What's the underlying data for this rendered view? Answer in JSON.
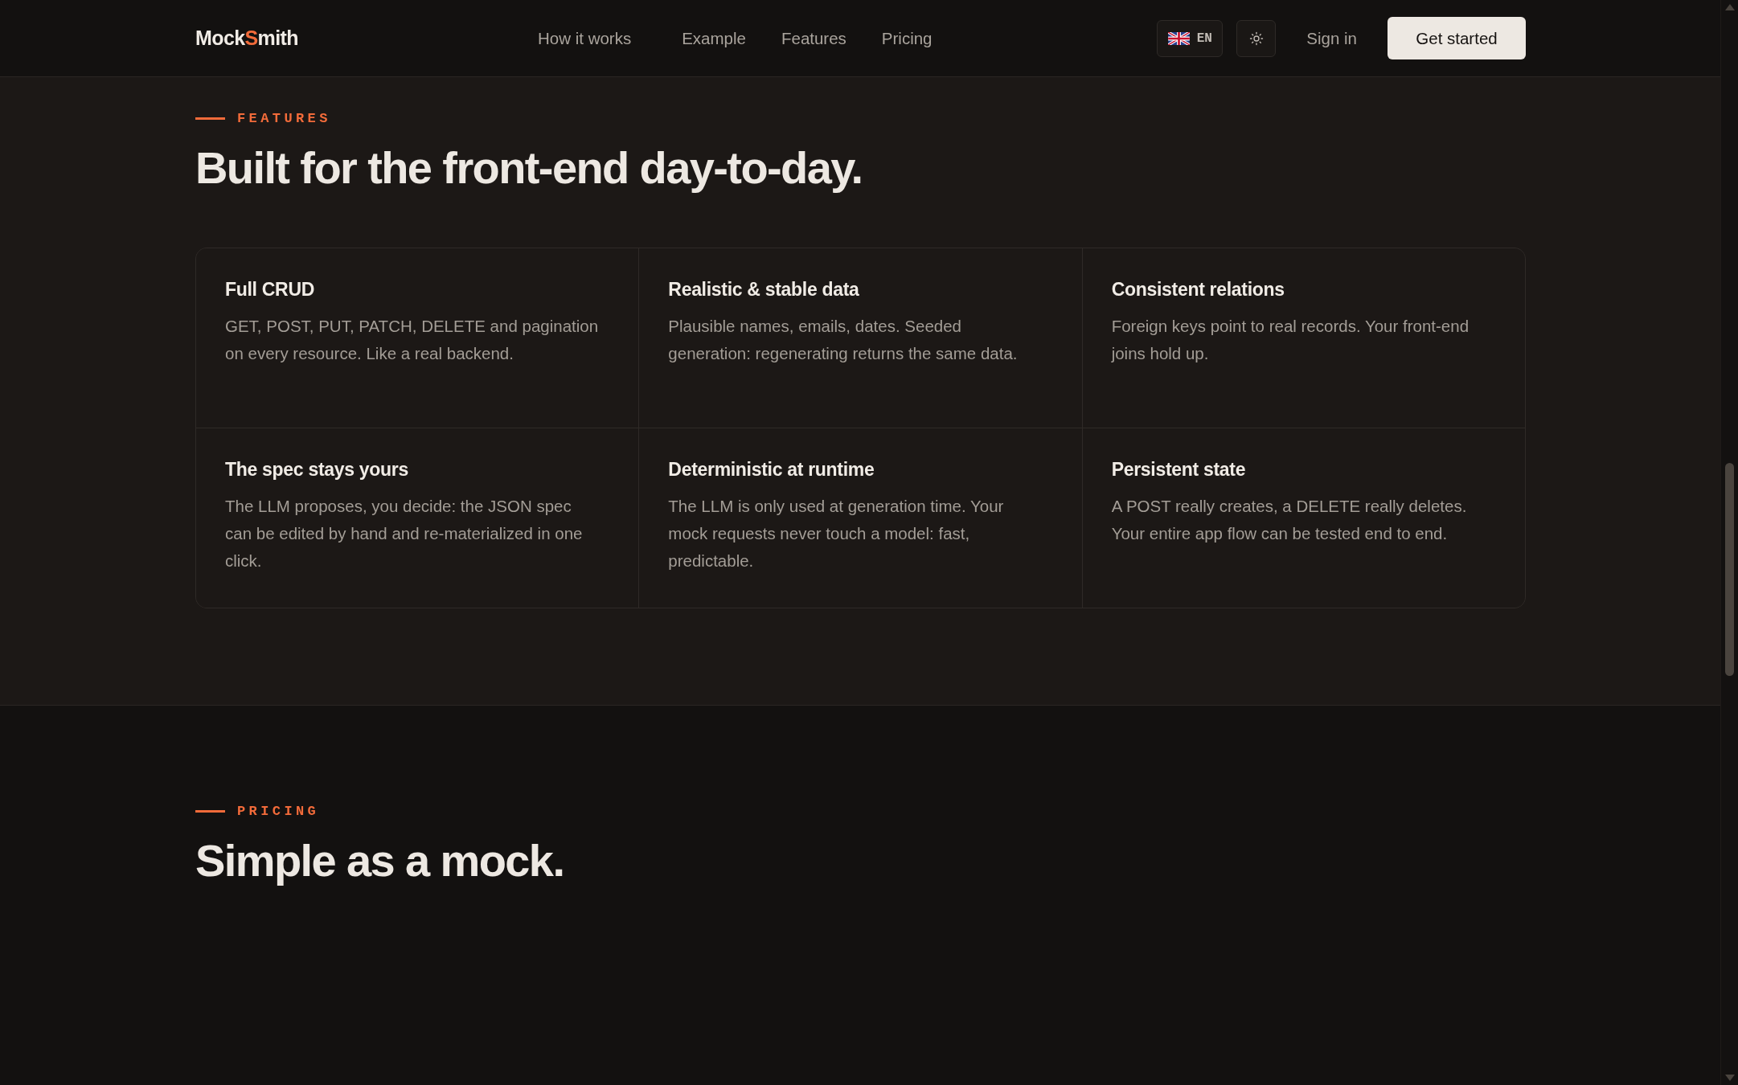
{
  "header": {
    "logo": {
      "before": "Mock",
      "accent": "S",
      "after": "mith"
    },
    "nav": [
      "How it works",
      "Example",
      "Features",
      "Pricing"
    ],
    "language": {
      "code": "EN"
    },
    "sign_in": "Sign in",
    "cta": "Get started"
  },
  "sections": [
    {
      "kind": "features",
      "eyebrow": "FEATURES",
      "title": "Built for the front-end day-to-day.",
      "features": [
        {
          "title": "Full CRUD",
          "description": "GET, POST, PUT, PATCH, DELETE and pagination on every resource. Like a real backend."
        },
        {
          "title": "Realistic & stable data",
          "description": "Plausible names, emails, dates. Seeded generation: regenerating returns the same data."
        },
        {
          "title": "Consistent relations",
          "description": "Foreign keys point to real records. Your front-end joins hold up."
        },
        {
          "title": "The spec stays yours",
          "description": "The LLM proposes, you decide: the JSON spec can be edited by hand and re-materialized in one click."
        },
        {
          "title": "Deterministic at runtime",
          "description": "The LLM is only used at generation time. Your mock requests never touch a model: fast, predictable."
        },
        {
          "title": "Persistent state",
          "description": "A POST really creates, a DELETE really deletes. Your entire app flow can be tested end to end."
        }
      ]
    },
    {
      "kind": "pricing",
      "eyebrow": "PRICING",
      "title": "Simple as a mock."
    }
  ]
}
